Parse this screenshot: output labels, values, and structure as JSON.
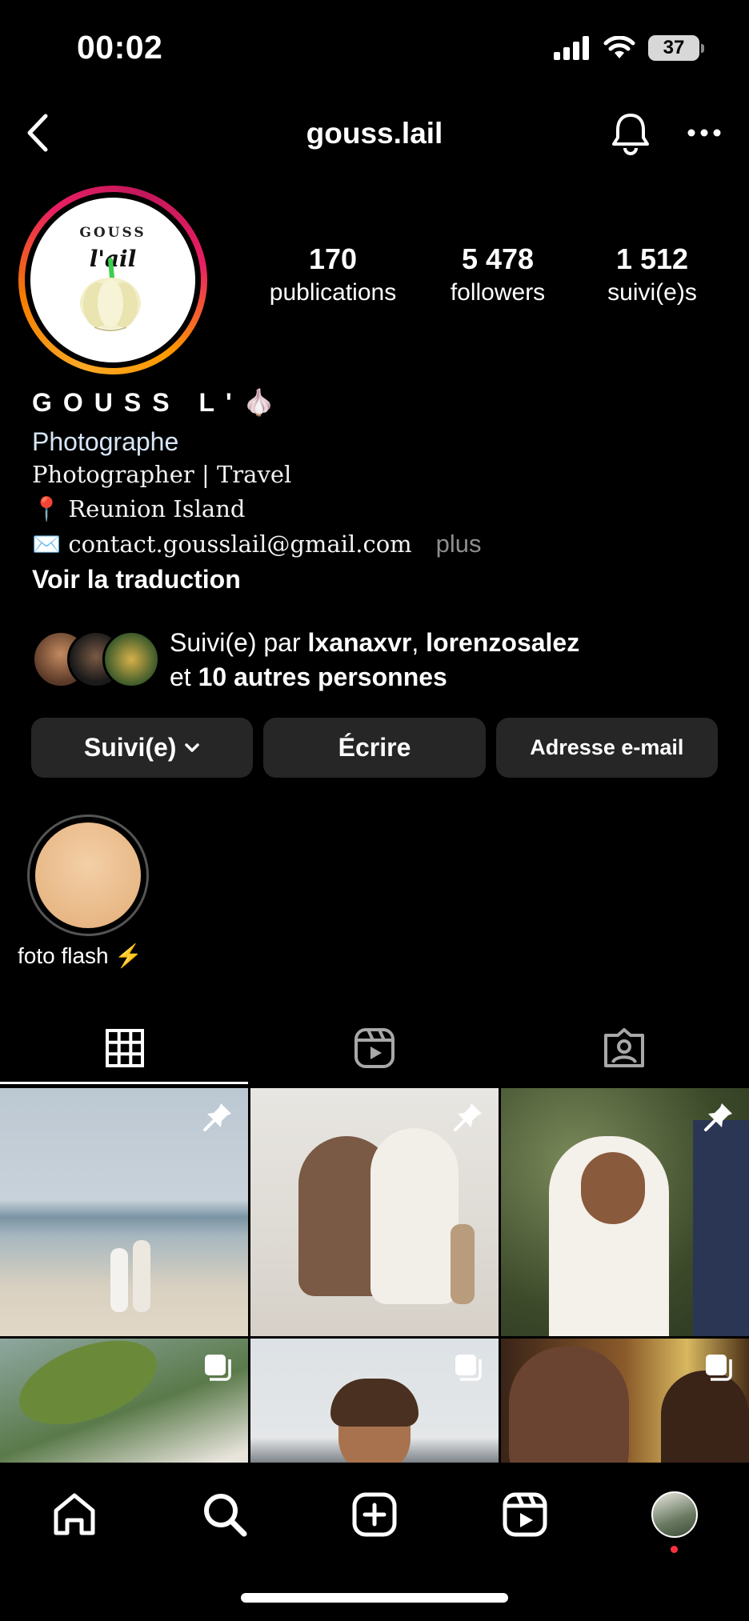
{
  "status_bar": {
    "time": "00:02",
    "battery": "37"
  },
  "header": {
    "username": "gouss.lail"
  },
  "profile": {
    "logo_line1": "GOUSS",
    "logo_line2": "l'ail",
    "stats": [
      {
        "value": "170",
        "label": "publications"
      },
      {
        "value": "5 478",
        "label": "followers"
      },
      {
        "value": "1 512",
        "label": "suivi(e)s"
      }
    ],
    "display_name": "GOUSS L'",
    "display_name_emoji": "🧄",
    "category": "Photographe",
    "bio": [
      "Photographer | Travel",
      "📍 Reunion Island",
      "✉️ contact.gousslail@gmail.com"
    ],
    "more_label": "plus",
    "translate_label": "Voir la traduction",
    "followed_by": {
      "prefix": "Suivi(e) par ",
      "user1": "lxanaxvr",
      "separator": ", ",
      "user2": "lorenzosalez",
      "line2_prefix": "et ",
      "others": "10 autres personnes"
    }
  },
  "actions": {
    "follow_label": "Suivi(e)",
    "message_label": "Écrire",
    "email_label": "Adresse e-mail"
  },
  "highlights": [
    {
      "label": "foto flash ⚡️"
    }
  ],
  "tabs": [
    {
      "icon": "grid-icon",
      "active": true
    },
    {
      "icon": "reels-icon",
      "active": false
    },
    {
      "icon": "tagged-icon",
      "active": false
    }
  ],
  "posts": [
    {
      "badge": "pin-icon"
    },
    {
      "badge": "pin-icon"
    },
    {
      "badge": "pin-icon"
    },
    {
      "badge": "carousel-icon"
    },
    {
      "badge": "carousel-icon"
    },
    {
      "badge": "carousel-icon"
    }
  ],
  "bottom_nav": [
    "home-icon",
    "search-icon",
    "create-icon",
    "reels-icon",
    "profile-avatar"
  ],
  "colors": {
    "accent_dot": "#ff3040",
    "button_bg": "#262626",
    "category_text": "#d7e6f8"
  }
}
